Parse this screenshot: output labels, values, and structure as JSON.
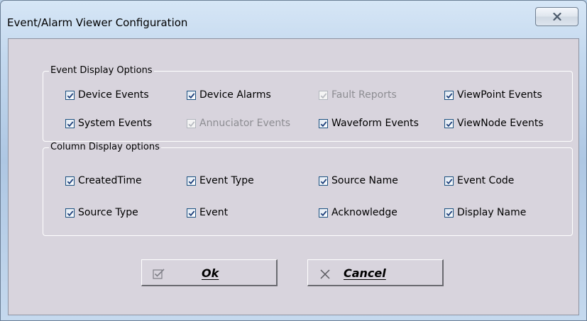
{
  "window": {
    "title": "Event/Alarm Viewer Configuration",
    "close_icon": "close-x-icon"
  },
  "event_display": {
    "legend": "Event Display Options",
    "options": [
      {
        "label": "Device Events",
        "checked": true,
        "enabled": true
      },
      {
        "label": "Device Alarms",
        "checked": true,
        "enabled": true
      },
      {
        "label": "Fault Reports",
        "checked": true,
        "enabled": false
      },
      {
        "label": "ViewPoint Events",
        "checked": true,
        "enabled": true
      },
      {
        "label": "System Events",
        "checked": true,
        "enabled": true
      },
      {
        "label": "Annuciator Events",
        "checked": true,
        "enabled": false
      },
      {
        "label": "Waveform Events",
        "checked": true,
        "enabled": true
      },
      {
        "label": "ViewNode Events",
        "checked": true,
        "enabled": true
      }
    ]
  },
  "column_display": {
    "legend": "Column Display options",
    "options": [
      {
        "label": "CreatedTime",
        "checked": true,
        "enabled": true
      },
      {
        "label": "Event Type",
        "checked": true,
        "enabled": true
      },
      {
        "label": "Source Name",
        "checked": true,
        "enabled": true
      },
      {
        "label": "Event Code",
        "checked": true,
        "enabled": true
      },
      {
        "label": "Source Type",
        "checked": true,
        "enabled": true
      },
      {
        "label": "Event",
        "checked": true,
        "enabled": true
      },
      {
        "label": "Acknowledge",
        "checked": true,
        "enabled": true
      },
      {
        "label": "Display Name",
        "checked": true,
        "enabled": true
      }
    ]
  },
  "buttons": {
    "ok_label": "Ok",
    "ok_icon": "checkmark-box-icon",
    "cancel_label": "Cancel",
    "cancel_icon": "x-icon"
  },
  "colors": {
    "checkbox_border": "#1c5180",
    "check_mark": "#1d3f7a",
    "disabled_text": "#8d8d92",
    "dialog_face": "#d8d4dd"
  }
}
